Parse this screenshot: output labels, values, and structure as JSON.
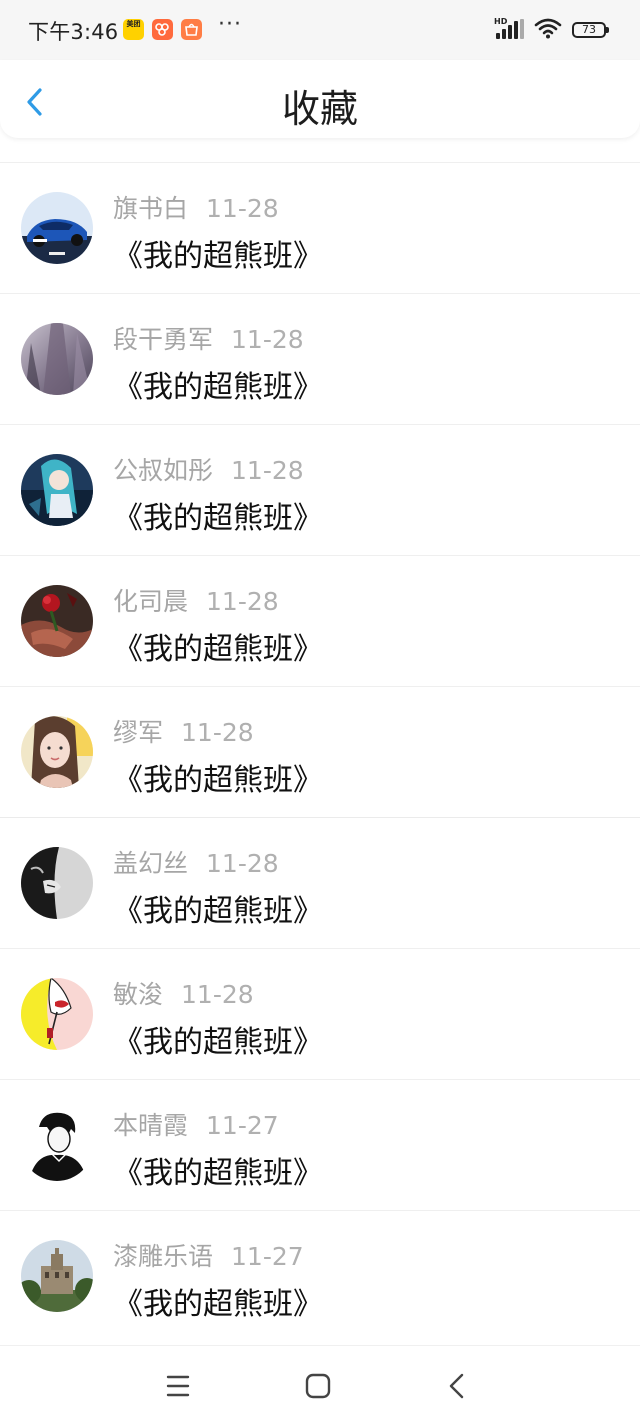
{
  "status_bar": {
    "time": "下午3:46",
    "battery": "73",
    "app_icons": [
      "美团",
      "app",
      "app"
    ],
    "more": "···"
  },
  "header": {
    "title": "收藏",
    "back_icon": "chevron-left-icon",
    "accent_color": "#2f9be6"
  },
  "favorites": [
    {
      "name": "旗书白",
      "date": "11-28",
      "title": "《我的超熊班》"
    },
    {
      "name": "段干勇军",
      "date": "11-28",
      "title": "《我的超熊班》"
    },
    {
      "name": "公叔如彤",
      "date": "11-28",
      "title": "《我的超熊班》"
    },
    {
      "name": "化司晨",
      "date": "11-28",
      "title": "《我的超熊班》"
    },
    {
      "name": "缪军",
      "date": "11-28",
      "title": "《我的超熊班》"
    },
    {
      "name": "盖幻丝",
      "date": "11-28",
      "title": "《我的超熊班》"
    },
    {
      "name": "敏浚",
      "date": "11-28",
      "title": "《我的超熊班》"
    },
    {
      "name": "本晴霞",
      "date": "11-27",
      "title": "《我的超熊班》"
    },
    {
      "name": "漆雕乐语",
      "date": "11-27",
      "title": "《我的超熊班》"
    }
  ],
  "nav_bar": {
    "buttons": [
      "menu-icon",
      "home-icon",
      "back-icon"
    ]
  }
}
